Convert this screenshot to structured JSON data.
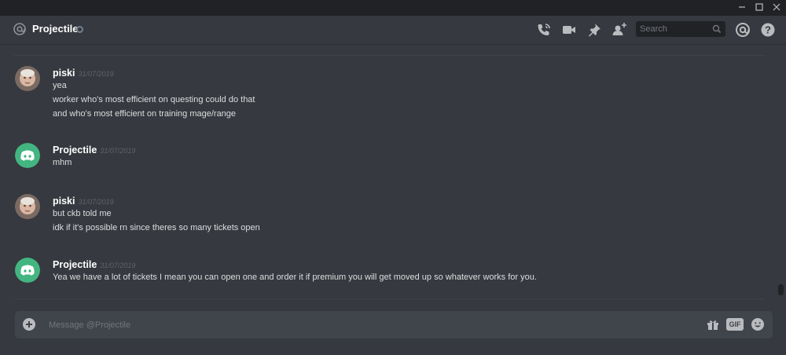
{
  "window": {
    "controls": [
      "minimize",
      "maximize",
      "close"
    ]
  },
  "header": {
    "channel_name": "Projectile",
    "search_placeholder": "Search",
    "icons": [
      "at-icon",
      "phone-call-icon",
      "video-icon",
      "pin-icon",
      "add-user-icon",
      "mention-icon",
      "help-icon"
    ]
  },
  "messages": [
    {
      "author": "piski",
      "timestamp": "31/07/2019",
      "avatar": "photo-avatar",
      "lines": [
        "yea",
        "worker who's most efficient on questing could do that",
        "and who's most efficient on training mage/range"
      ]
    },
    {
      "author": "Projectile",
      "timestamp": "31/07/2019",
      "avatar": "discord-logo-avatar",
      "lines": [
        "mhm"
      ]
    },
    {
      "author": "piski",
      "timestamp": "31/07/2019",
      "avatar": "photo-avatar",
      "lines": [
        "but ckb told me",
        "idk if it's possible rn since theres so many tickets open"
      ]
    },
    {
      "author": "Projectile",
      "timestamp": "31/07/2019",
      "avatar": "discord-logo-avatar",
      "lines": [
        "Yea we have a lot of tickets I mean you can open one and order it if premium you will get moved up so whatever works for you."
      ]
    }
  ],
  "composer": {
    "placeholder": "Message @Projectile",
    "gif_label": "GIF",
    "icons": [
      "plus-icon",
      "gift-icon",
      "gif-icon",
      "emoji-icon"
    ]
  },
  "colors": {
    "background": "#36393f",
    "titlebar": "#202225",
    "composer": "#40444b",
    "discord_green": "#43b581",
    "text": "#dcddde"
  }
}
